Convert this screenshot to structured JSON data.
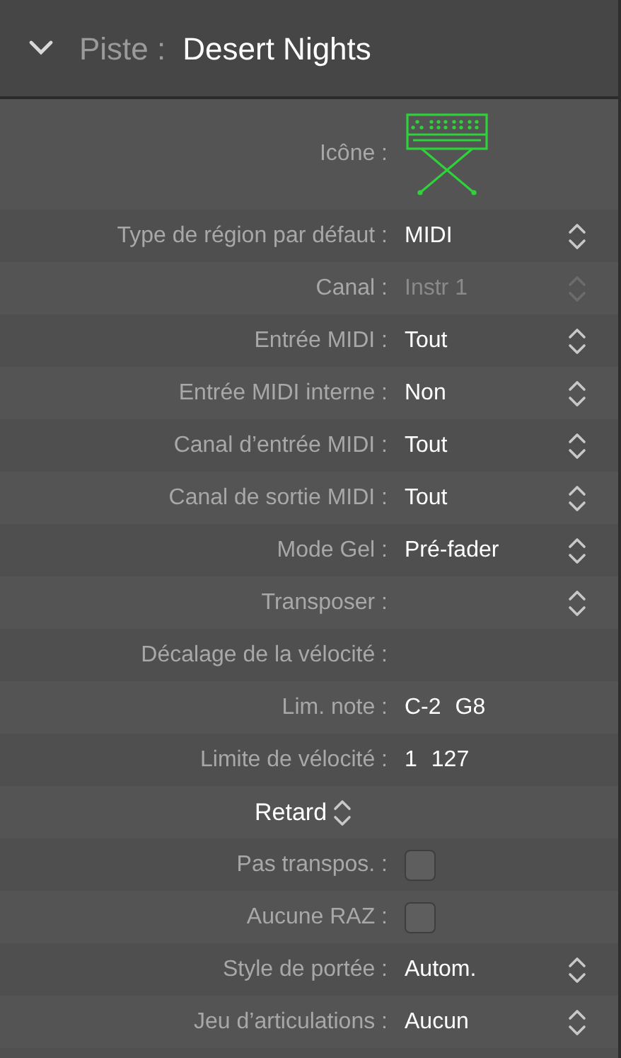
{
  "header": {
    "expanded": true,
    "label": "Piste :",
    "title": "Desert Nights"
  },
  "rows": [
    {
      "kind": "icon",
      "label": "Icône  :"
    },
    {
      "kind": "popup",
      "label": "Type de région par défaut :",
      "value": "MIDI",
      "disabled": false
    },
    {
      "kind": "popup",
      "label": "Canal  :",
      "value": "Instr 1",
      "disabled": true
    },
    {
      "kind": "popup",
      "label": "Entrée MIDI :",
      "value": "Tout",
      "disabled": false
    },
    {
      "kind": "popup",
      "label": "Entrée MIDI interne :",
      "value": "Non",
      "disabled": false
    },
    {
      "kind": "popup",
      "label": "Canal d’entrée MIDI :",
      "value": "Tout",
      "disabled": false
    },
    {
      "kind": "popup",
      "label": "Canal de sortie MIDI :",
      "value": "Tout",
      "disabled": false
    },
    {
      "kind": "popup",
      "label": "Mode Gel  :",
      "value": "Pré-fader",
      "disabled": false
    },
    {
      "kind": "popup",
      "label": "Transposer  :",
      "disabled": false
    },
    {
      "kind": "heading",
      "label": "Décalage de la vélocité :"
    },
    {
      "kind": "range",
      "label": "Lim. note  :",
      "low": "C-2",
      "high": "G8"
    },
    {
      "kind": "range",
      "label": "Limite de vélocité :",
      "low": "1",
      "high": "127"
    },
    {
      "kind": "section",
      "label": "Retard"
    },
    {
      "kind": "checkbox",
      "label": "Pas transpos.  :",
      "checked": false
    },
    {
      "kind": "checkbox",
      "label": "Aucune RAZ :",
      "checked": false
    },
    {
      "kind": "popup",
      "label": "Style de portée :",
      "value": "Autom.",
      "disabled": false
    },
    {
      "kind": "popup",
      "label": "Jeu d’articulations :",
      "value": "Aucun",
      "disabled": false
    }
  ]
}
